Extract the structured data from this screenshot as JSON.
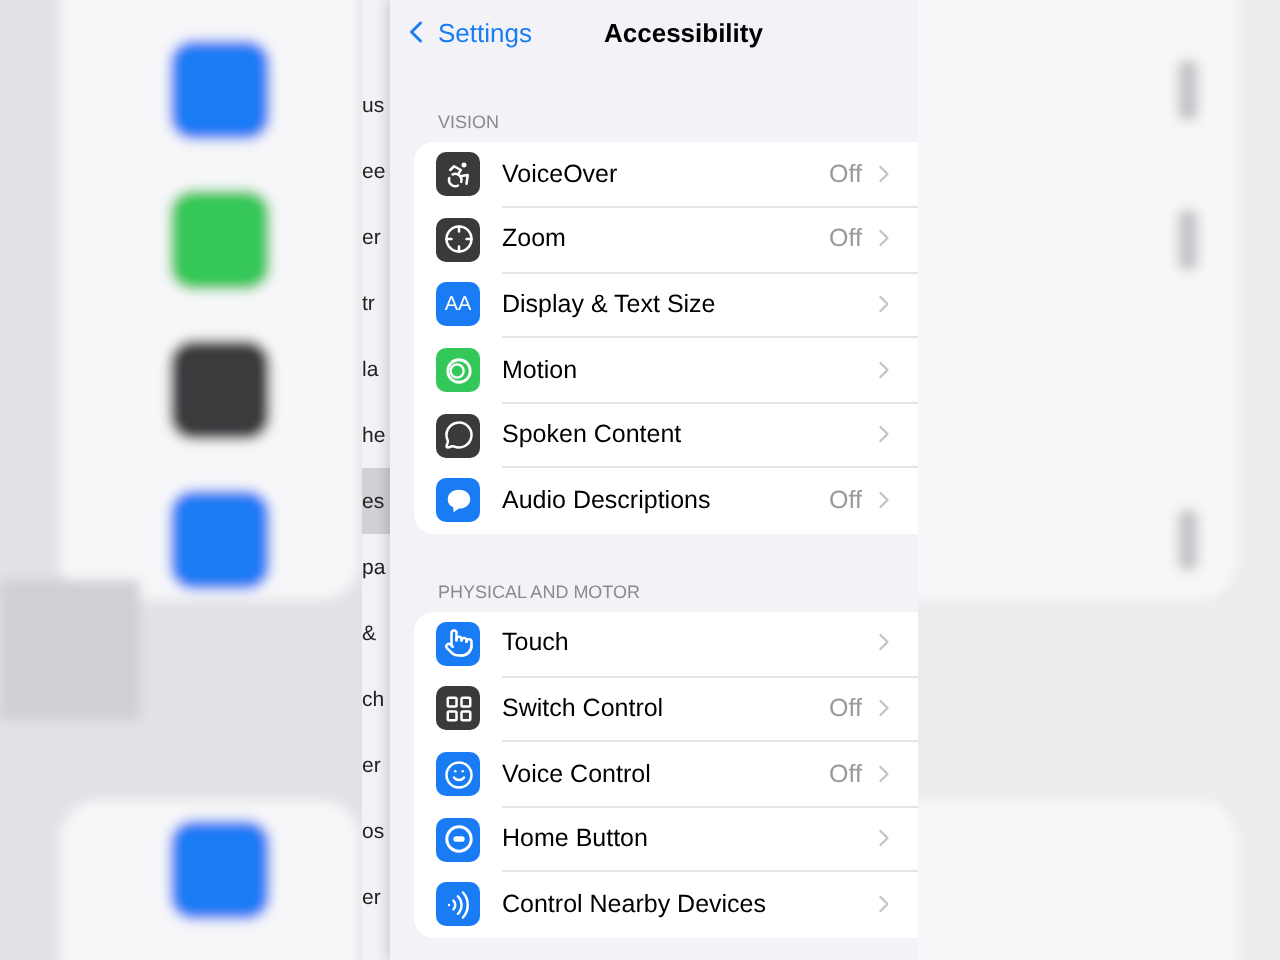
{
  "nav": {
    "back": "Settings",
    "title": "Accessibility"
  },
  "behind_list": [
    {
      "text": "us",
      "selected": false
    },
    {
      "text": "ee",
      "selected": false
    },
    {
      "text": "er",
      "selected": false
    },
    {
      "text": "tr",
      "selected": false
    },
    {
      "text": "la",
      "selected": false
    },
    {
      "text": "he",
      "selected": false
    },
    {
      "text": "es",
      "selected": true
    },
    {
      "text": "pa",
      "selected": false
    },
    {
      "text": "&",
      "selected": false
    },
    {
      "text": "ch",
      "selected": false
    },
    {
      "text": "er",
      "selected": false
    },
    {
      "text": "os",
      "selected": false
    },
    {
      "text": "er",
      "selected": false
    }
  ],
  "sections": [
    {
      "header": "VISION",
      "items": [
        {
          "label": "VoiceOver",
          "value": "Off",
          "kind": "voiceover",
          "color": "#3a3a3c"
        },
        {
          "label": "Zoom",
          "value": "Off",
          "kind": "zoom",
          "color": "#3a3a3c"
        },
        {
          "label": "Display & Text Size",
          "kind": "text",
          "icon_text": "AA",
          "color": "#1a7cf5"
        },
        {
          "label": "Motion",
          "kind": "motion",
          "color": "#34c759"
        },
        {
          "label": "Spoken Content",
          "kind": "speech",
          "color": "#3a3a3c"
        },
        {
          "label": "Audio Descriptions",
          "value": "Off",
          "kind": "bubble",
          "color": "#1a7cf5"
        }
      ]
    },
    {
      "header": "PHYSICAL AND MOTOR",
      "items": [
        {
          "label": "Touch",
          "kind": "touch",
          "color": "#1a7cf5"
        },
        {
          "label": "Switch Control",
          "value": "Off",
          "kind": "grid",
          "color": "#3a3a3c"
        },
        {
          "label": "Voice Control",
          "value": "Off",
          "kind": "voice",
          "color": "#1a7cf5"
        },
        {
          "label": "Home Button",
          "kind": "home",
          "color": "#1a7cf5"
        },
        {
          "label": "Control Nearby Devices",
          "kind": "nearby",
          "color": "#1a7cf5"
        }
      ]
    }
  ]
}
